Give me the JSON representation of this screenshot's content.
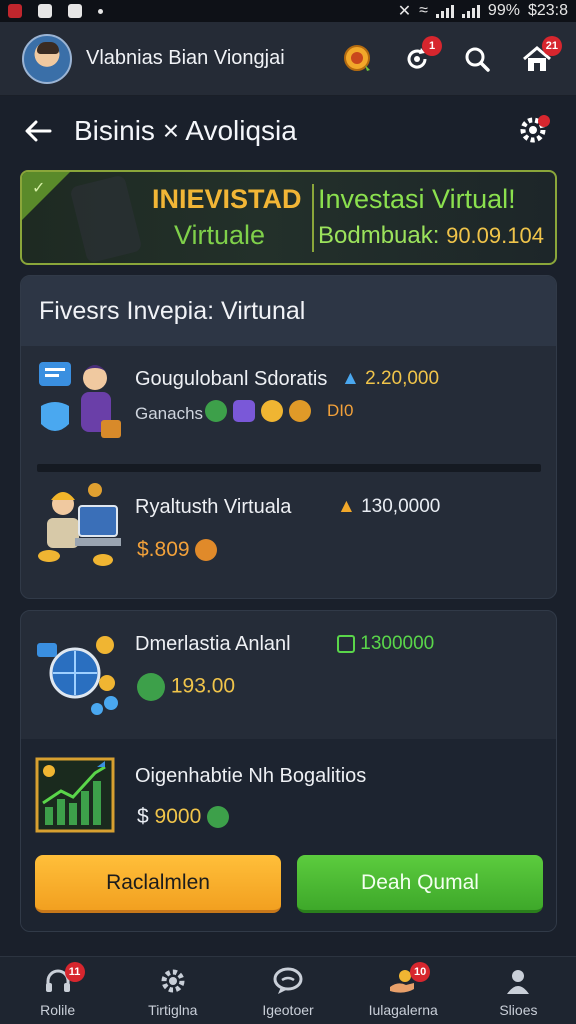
{
  "status_bar": {
    "battery": "99%",
    "time": "$23:8"
  },
  "app_bar": {
    "user_name": "Vlabnias Bian Viongjai",
    "badges": {
      "refresh": "1",
      "home": "21"
    }
  },
  "header": {
    "title": "Bisinis × Avoliqsia"
  },
  "banner": {
    "headline_left": "INIEVISTAD",
    "sub_left": "Virtuale",
    "headline_right": "Investasi Virtual!",
    "balance_label": "Bodmbuak:",
    "balance_value": "90.09.104"
  },
  "card_investments": {
    "title": "Fivesrs Invepia: Virtunal",
    "items": [
      {
        "name": "Gougulobanl Sdoratis",
        "amount": "2.20,000",
        "sub": "Ganachs",
        "tag": "DI0"
      },
      {
        "name": "Ryaltusth Virtuala",
        "amount": "130,0000",
        "price": "$.809"
      }
    ]
  },
  "card_offers": {
    "items": [
      {
        "name": "Dmerlastia Anlanl",
        "amount": "1300000",
        "value": "193.00"
      },
      {
        "name": "Oigenhabtie Nh Bogalitios",
        "price_symbol": "$",
        "price": "9000"
      }
    ],
    "buttons": {
      "left": "Raclalmlen",
      "right": "Deah Qumal"
    }
  },
  "bottom_nav": {
    "items": [
      {
        "label": "Rolile",
        "badge": "11"
      },
      {
        "label": "Tirtiglna"
      },
      {
        "label": "Igeotoer"
      },
      {
        "label": "Iulagalerna",
        "badge": "10"
      },
      {
        "label": "Slioes"
      }
    ]
  },
  "colors": {
    "background": "#1a202b",
    "accent_orange": "#f2a020",
    "accent_green": "#3ea82a",
    "amount_yellow": "#f0c44a",
    "amount_green": "#5ad64a",
    "price_orange": "#f2a13a",
    "badge_red": "#d7262e"
  }
}
